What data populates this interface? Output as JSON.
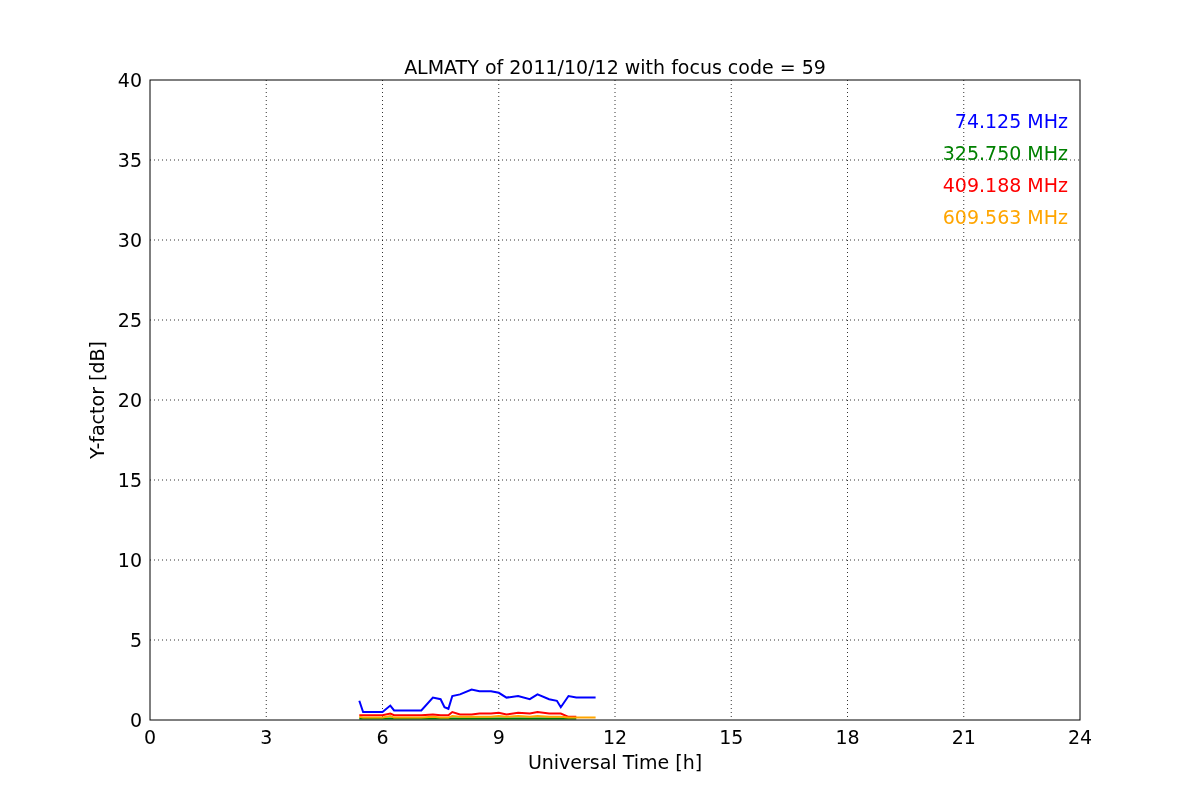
{
  "chart": {
    "chart_data": {
      "type": "line",
      "title": "ALMATY of 2011/10/12 with focus code = 59",
      "xlabel": "Universal Time [h]",
      "ylabel": "Y-factor [dB]",
      "x": [
        5.4,
        5.5,
        5.6,
        5.9,
        6.0,
        6.2,
        6.3,
        6.5,
        7.0,
        7.3,
        7.5,
        7.6,
        7.7,
        7.8,
        8.0,
        8.3,
        8.5,
        8.8,
        9.0,
        9.2,
        9.5,
        9.8,
        10.0,
        10.3,
        10.5,
        10.6,
        10.8,
        11.0,
        11.3,
        11.5
      ],
      "series": [
        {
          "name": "74.125 MHz",
          "color": "#0000ff",
          "values": [
            1.2,
            0.5,
            0.5,
            0.5,
            0.5,
            0.9,
            0.6,
            0.6,
            0.6,
            1.4,
            1.3,
            0.8,
            0.7,
            1.5,
            1.6,
            1.9,
            1.8,
            1.8,
            1.7,
            1.4,
            1.5,
            1.3,
            1.6,
            1.3,
            1.2,
            0.8,
            1.5,
            1.4,
            1.4,
            1.4
          ]
        },
        {
          "name": "325.750 MHz",
          "color": "#008000",
          "values": [
            0.1,
            0.1,
            0.1,
            0.1,
            0.1,
            0.1,
            0.1,
            0.1,
            0.1,
            0.1,
            0.1,
            0.1,
            0.1,
            0.1,
            0.1,
            0.1,
            0.1,
            0.1,
            0.1,
            0.1,
            0.1,
            0.1,
            0.1,
            0.1,
            0.1,
            0.1,
            0.1,
            0.1,
            null,
            null
          ]
        },
        {
          "name": "409.188 MHz",
          "color": "#ff0000",
          "values": [
            0.3,
            0.3,
            0.3,
            0.3,
            0.3,
            0.4,
            0.3,
            0.3,
            0.3,
            0.35,
            0.3,
            0.3,
            0.3,
            0.5,
            0.35,
            0.35,
            0.4,
            0.4,
            0.45,
            0.35,
            0.45,
            0.4,
            0.5,
            0.4,
            0.4,
            0.4,
            0.2,
            0.2,
            null,
            null
          ]
        },
        {
          "name": "609.563 MHz",
          "color": "#ffa500",
          "values": [
            0.2,
            0.15,
            0.15,
            0.15,
            0.15,
            0.25,
            0.15,
            0.15,
            0.15,
            0.2,
            0.15,
            0.15,
            0.15,
            0.25,
            0.2,
            0.2,
            0.2,
            0.2,
            0.25,
            0.2,
            0.25,
            0.2,
            0.25,
            0.2,
            0.2,
            0.2,
            0.15,
            0.15,
            0.15,
            0.15
          ]
        }
      ],
      "grid": true,
      "xlim": [
        0,
        24
      ],
      "ylim": [
        0,
        40
      ],
      "xticks": [
        0,
        3,
        6,
        9,
        12,
        15,
        18,
        21,
        24
      ],
      "yticks": [
        0,
        5,
        10,
        15,
        20,
        25,
        30,
        35,
        40
      ]
    }
  }
}
